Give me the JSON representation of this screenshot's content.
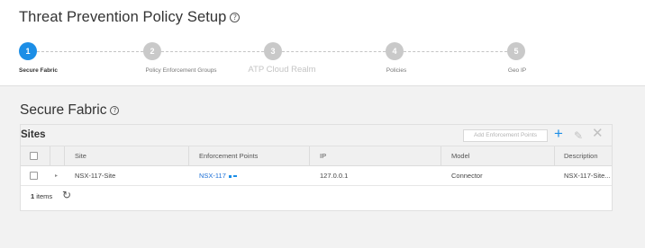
{
  "header": {
    "title": "Threat Prevention Policy Setup",
    "help_icon": "?"
  },
  "stepper": {
    "steps": [
      {
        "number": "1",
        "label": "Secure Fabric",
        "active": true
      },
      {
        "number": "2",
        "label": "Policy Enforcement Groups",
        "active": false
      },
      {
        "number": "3",
        "label": "ATP Cloud Realm",
        "active": false
      },
      {
        "number": "4",
        "label": "Policies",
        "active": false
      },
      {
        "number": "5",
        "label": "Geo IP",
        "active": false
      }
    ]
  },
  "section": {
    "title": "Secure Fabric",
    "help_icon": "?"
  },
  "sites_panel": {
    "title": "Sites",
    "add_button": "Add Enforcement Points",
    "icons": {
      "add": "plus-icon",
      "edit": "pencil-icon",
      "delete": "close-icon"
    },
    "columns": [
      "Site",
      "Enforcement Points",
      "IP",
      "Model",
      "Description"
    ],
    "rows": [
      {
        "site": "NSX-117-Site",
        "enforcement_points": "NSX-117",
        "ip": "127.0.0.1",
        "model": "Connector",
        "description": "NSX-117-Site..."
      }
    ],
    "footer": {
      "count": "1",
      "count_label": "items",
      "refresh_icon": "refresh-icon"
    }
  },
  "colors": {
    "accent": "#1c8ee6",
    "step_inactive": "#c9c9c9",
    "link": "#1c6fd6"
  }
}
